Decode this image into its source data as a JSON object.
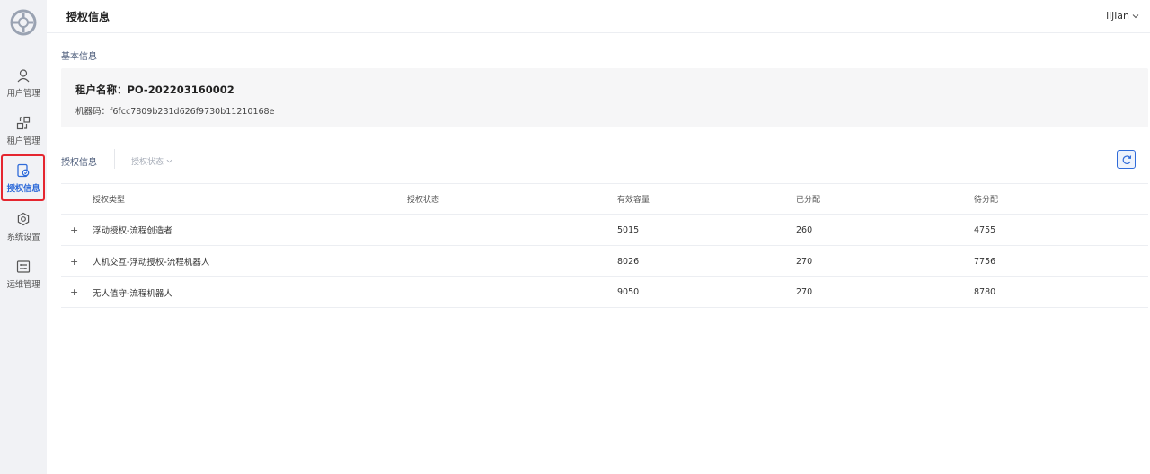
{
  "header": {
    "title": "授权信息",
    "user": "lijian"
  },
  "sidebar": {
    "items": [
      {
        "label": "用户管理",
        "icon": "user-icon"
      },
      {
        "label": "租户管理",
        "icon": "tenant-icon"
      },
      {
        "label": "授权信息",
        "icon": "license-icon",
        "active": true
      },
      {
        "label": "系统设置",
        "icon": "settings-icon"
      },
      {
        "label": "运维管理",
        "icon": "ops-icon"
      }
    ]
  },
  "basic": {
    "section_label": "基本信息",
    "tenant_label": "租户名称：",
    "tenant_value": "PO-202203160002",
    "machine_label": "机器码：",
    "machine_value": "f6fcc7809b231d626f9730b11210168e"
  },
  "toolbar": {
    "label": "授权信息",
    "status_filter": "授权状态"
  },
  "table": {
    "columns": [
      "授权类型",
      "授权状态",
      "有效容量",
      "已分配",
      "待分配"
    ],
    "rows": [
      {
        "type": "浮动授权-流程创造者",
        "status": "",
        "capacity": "5015",
        "assigned": "260",
        "pending": "4755"
      },
      {
        "type": "人机交互-浮动授权-流程机器人",
        "status": "",
        "capacity": "8026",
        "assigned": "270",
        "pending": "7756"
      },
      {
        "type": "无人值守-流程机器人",
        "status": "",
        "capacity": "9050",
        "assigned": "270",
        "pending": "8780"
      }
    ]
  },
  "colors": {
    "accent": "#2f6bd9",
    "highlight": "#e5262f",
    "sidebar_bg": "#f1f2f5"
  }
}
